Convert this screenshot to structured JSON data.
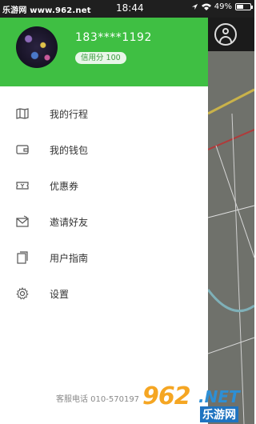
{
  "statusbar": {
    "watermark": "乐游网 www.962.net",
    "time": "18:44",
    "battery_text": "49%",
    "battery_level": 0.49
  },
  "profile": {
    "phone": "183****1192",
    "credit": "信用分 100"
  },
  "menu": [
    {
      "label": "我的行程",
      "icon": "map-book-icon"
    },
    {
      "label": "我的钱包",
      "icon": "wallet-icon"
    },
    {
      "label": "优惠券",
      "icon": "ticket-icon"
    },
    {
      "label": "邀请好友",
      "icon": "invite-envelope-icon"
    },
    {
      "label": "用户指南",
      "icon": "guide-document-icon"
    },
    {
      "label": "设置",
      "icon": "gear-icon"
    }
  ],
  "footer": {
    "service_phone": "客服电话 010-570197"
  },
  "watermark_logo": {
    "main": "962",
    "suffix": ".NET",
    "sub": "乐游网"
  },
  "colors": {
    "header_green": "#3fbf43",
    "statusbar": "#1f1f1f"
  }
}
